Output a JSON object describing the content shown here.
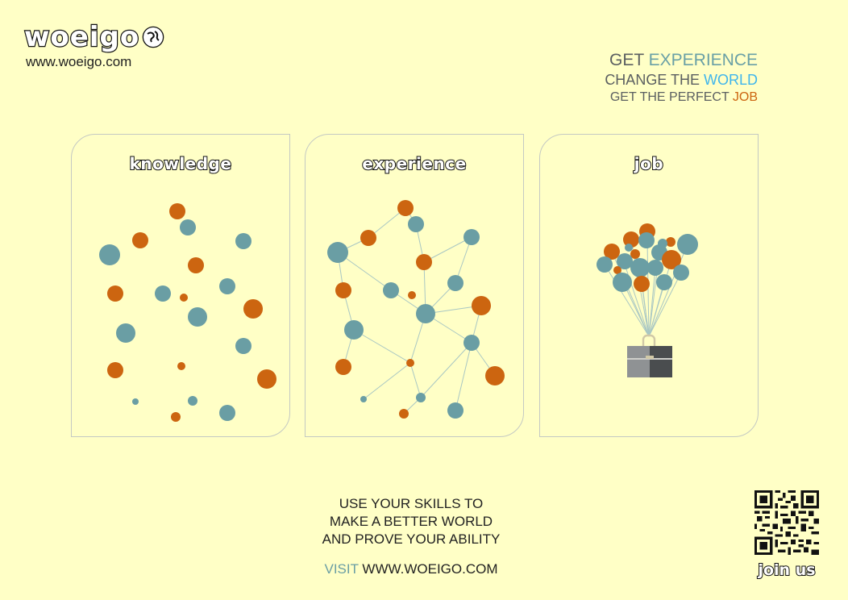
{
  "brand": {
    "name": "woeigo",
    "url": "www.woeigo.com"
  },
  "tagline": {
    "line1_prefix": "GET ",
    "line1_highlight": "EXPERIENCE",
    "line2_prefix": "CHANGE THE ",
    "line2_highlight": "WORLD",
    "line3_prefix": "GET THE PERFECT ",
    "line3_highlight": "JOB"
  },
  "cards": [
    {
      "title": "knowledge"
    },
    {
      "title": "experience"
    },
    {
      "title": "job"
    }
  ],
  "bottom": {
    "line1": "USE YOUR SKILLS TO",
    "line2": "MAKE A BETTER WORLD",
    "line3": "AND PROVE YOUR ABILITY",
    "visit_label": "VISIT",
    "visit_url": "WWW.WOEIGO.COM",
    "join_label": "join us"
  },
  "colors": {
    "background": "#ffffc6",
    "teal": "#6a9ea4",
    "orange": "#cc6510",
    "blue": "#3fb5ec",
    "gray_text": "#5b5f61"
  },
  "icons": [
    "globe-icon",
    "briefcase-icon",
    "qr-code-icon"
  ]
}
